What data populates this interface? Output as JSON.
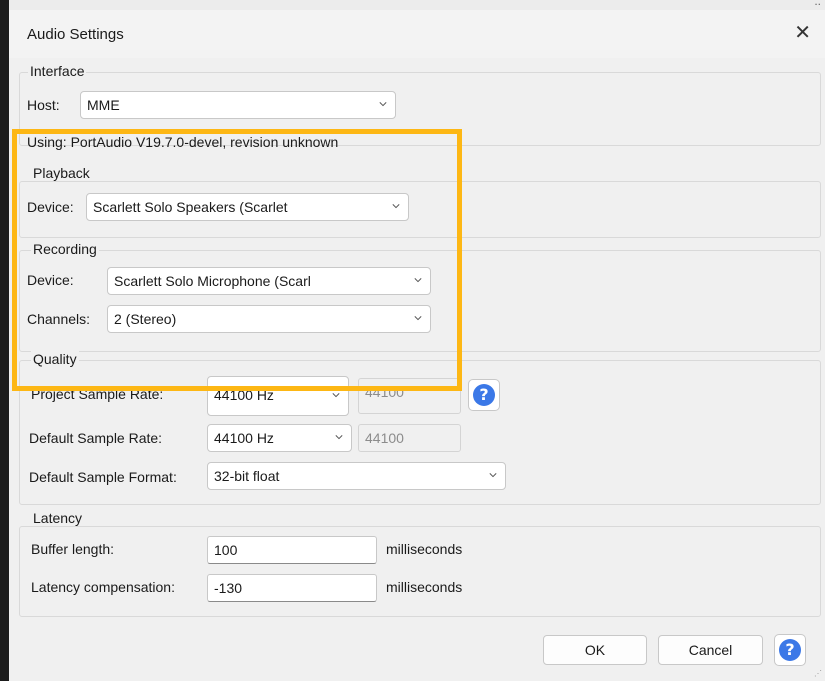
{
  "window": {
    "title": "Audio Settings"
  },
  "interface": {
    "legend": "Interface",
    "host_label": "Host:",
    "host_value": "MME",
    "using_text": "Using: PortAudio V19.7.0-devel, revision unknown"
  },
  "playback": {
    "legend": "Playback",
    "device_label": "Device:",
    "device_value": "Scarlett Solo Speakers (Scarlet"
  },
  "recording": {
    "legend": "Recording",
    "device_label": "Device:",
    "device_value": "Scarlett Solo Microphone (Scarl",
    "channels_label": "Channels:",
    "channels_value": "2 (Stereo)"
  },
  "quality": {
    "legend": "Quality",
    "project_rate_label": "Project Sample Rate:",
    "project_rate_value": "44100 Hz",
    "project_rate_text": "44100",
    "default_rate_label": "Default Sample Rate:",
    "default_rate_value": "44100 Hz",
    "default_rate_text": "44100",
    "format_label": "Default Sample Format:",
    "format_value": "32-bit float"
  },
  "latency": {
    "legend": "Latency",
    "buffer_label": "Buffer length:",
    "buffer_value": "100",
    "buffer_unit": "milliseconds",
    "comp_label": "Latency compensation:",
    "comp_value": "-130",
    "comp_unit": "milliseconds"
  },
  "buttons": {
    "ok": "OK",
    "cancel": "Cancel",
    "help": "?"
  },
  "colors": {
    "highlight": "#fdb714",
    "help_blue": "#3b78e7"
  }
}
